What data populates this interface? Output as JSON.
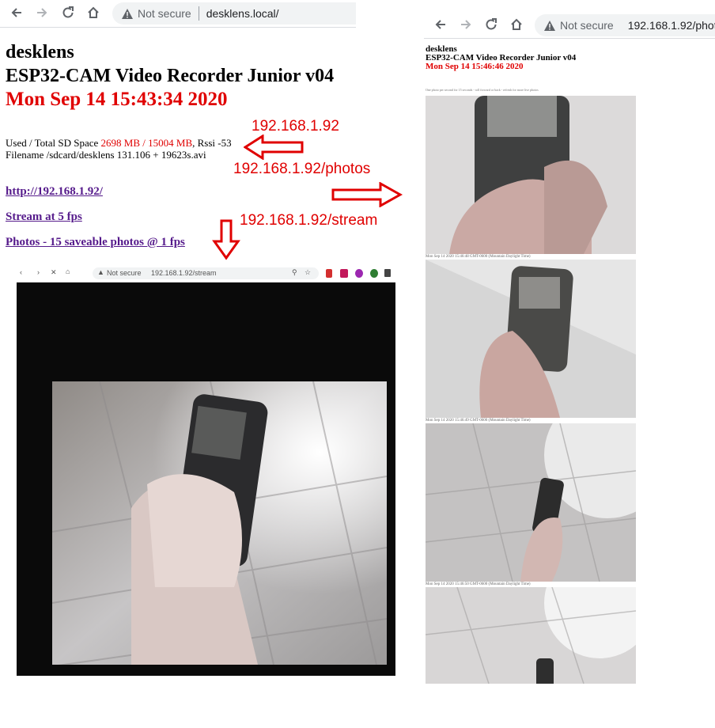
{
  "left_browser": {
    "security_label": "Not secure",
    "url": "desklens.local/"
  },
  "right_browser": {
    "security_label": "Not secure",
    "url": "192.168.1.92/phot"
  },
  "main_page": {
    "site_name": "desklens",
    "app_title": "ESP32-CAM Video Recorder Junior v04",
    "datetime": "Mon Sep 14 15:43:34 2020",
    "sd_prefix": "Used / Total SD Space ",
    "sd_used": "2698 MB",
    "sd_slash": " / ",
    "sd_total": "15004 MB",
    "rssi": ", Rssi -53",
    "filename": "Filename /sdcard/desklens 131.106 + 19623s.avi",
    "link_home": "http://192.168.1.92/",
    "link_stream": "Stream at 5 fps",
    "link_photos": "Photos - 15 saveable photos @ 1 fps"
  },
  "annotations": {
    "home": "192.168.1.92",
    "photos": "192.168.1.92/photos",
    "stream": "192.168.1.92/stream"
  },
  "stream_browser": {
    "security_label": "Not secure",
    "url": "192.168.1.92/stream"
  },
  "photos_page": {
    "site_name": "desklens",
    "app_title": "ESP32-CAM Video Recorder Junior v04",
    "datetime": "Mon Sep 14 15:46:46 2020",
    "note": "One photo per second for 15 seconds - roll forward or back - refresh for more live photos",
    "timestamps": [
      "Mon Sep 14 2020 15:46:48 GMT-0600 (Mountain Daylight Time)",
      "Mon Sep 14 2020 15:46:49 GMT-0600 (Mountain Daylight Time)",
      "Mon Sep 14 2020 15:46:50 GMT-0600 (Mountain Daylight Time)"
    ]
  },
  "colors": {
    "accent_red": "#e00000",
    "visited_link": "#551a8b"
  }
}
